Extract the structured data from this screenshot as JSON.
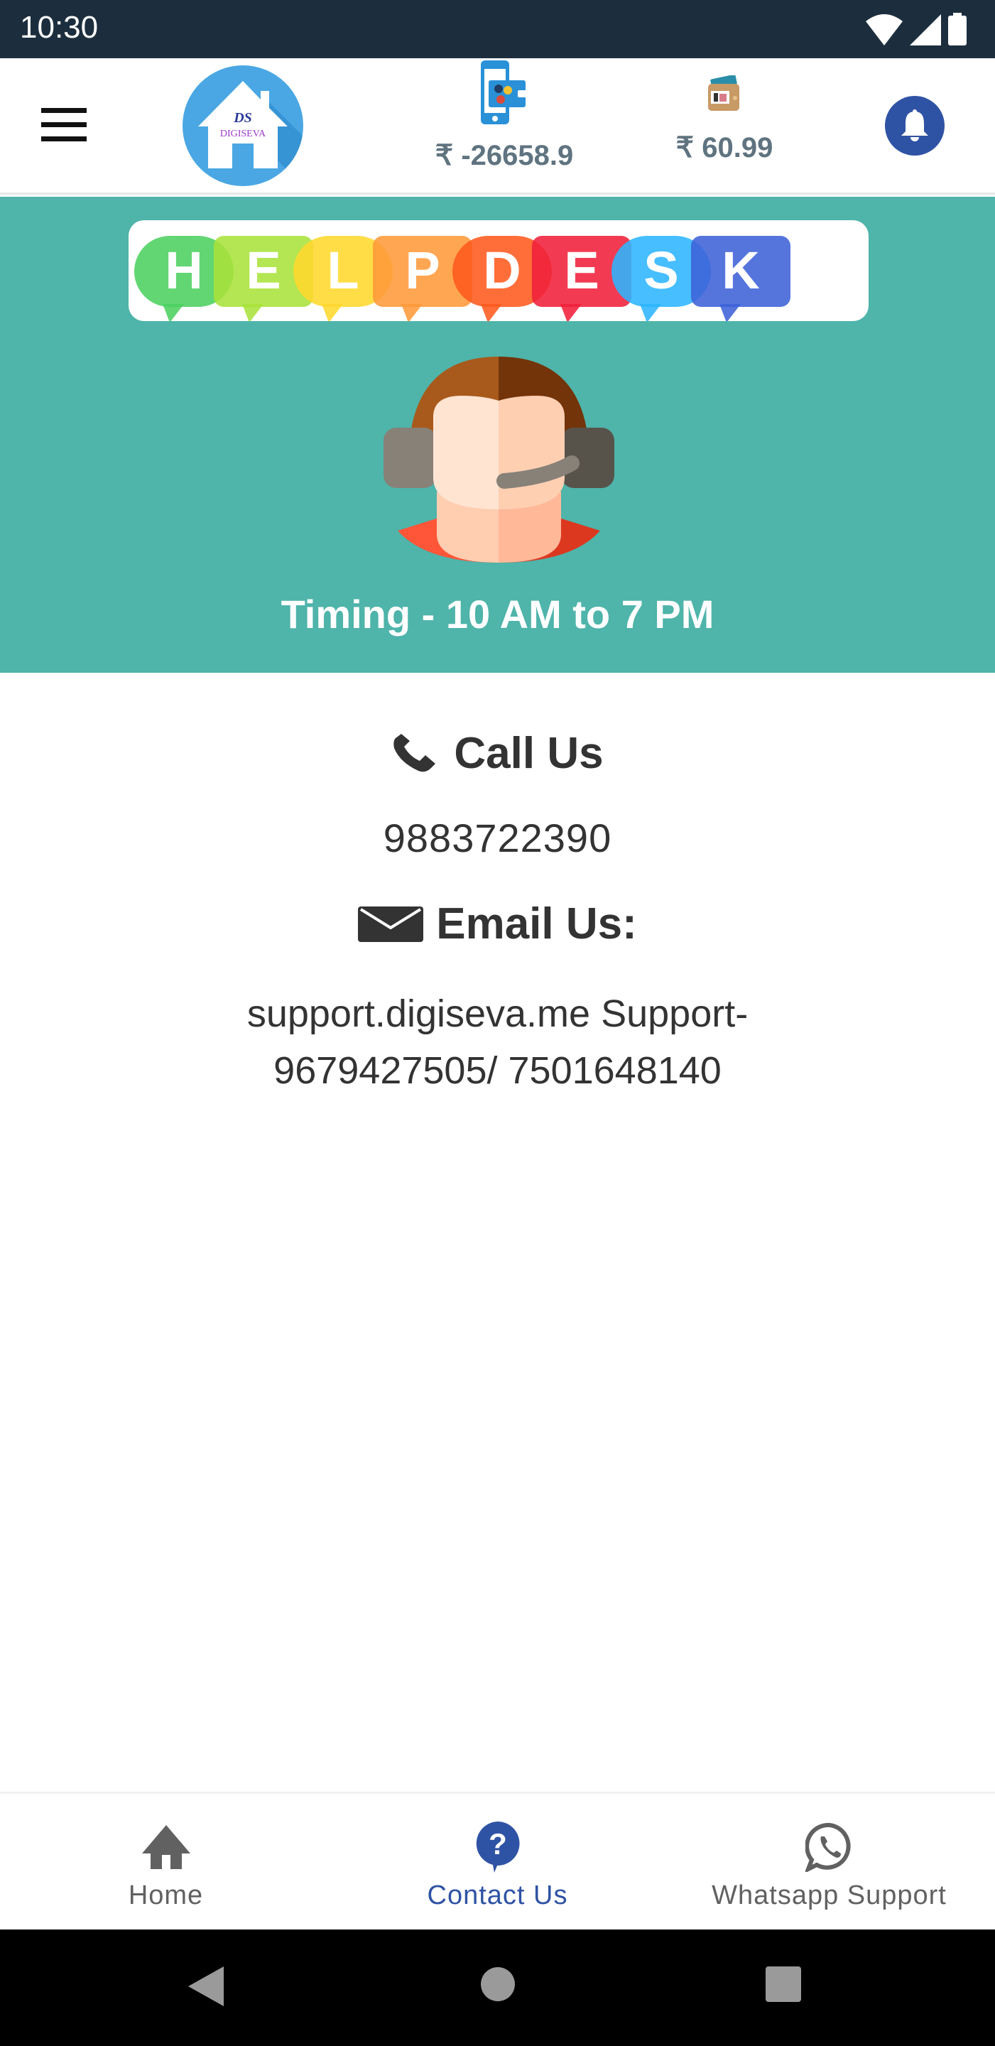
{
  "status_bar": {
    "time": "10:30",
    "icons": [
      "wifi-icon",
      "signal-icon",
      "battery-icon"
    ]
  },
  "app_bar": {
    "menu_icon": "hamburger-menu-icon",
    "logo": {
      "brand": "DIGISEVA",
      "mark": "DS"
    },
    "wallets": [
      {
        "icon": "mobile-wallet-icon",
        "amount": "₹ -26658.9"
      },
      {
        "icon": "wallet-icon",
        "amount": "₹ 60.99"
      }
    ],
    "notification_icon": "bell-icon"
  },
  "banner": {
    "helpdesk_letters": [
      "H",
      "E",
      "L",
      "P",
      "D",
      "E",
      "S",
      "K"
    ],
    "helpdesk_colors": [
      "#4cd060",
      "#a8e23a",
      "#ffd82e",
      "#ff9a3a",
      "#ff5a1e",
      "#f0203a",
      "#2cb5ff",
      "#3d62d8"
    ],
    "timing": "Timing - 10 AM to 7 PM",
    "background_color": "#4fb4aa"
  },
  "contact": {
    "call_heading": "Call Us",
    "call_number": "9883722390",
    "email_heading": "Email Us:",
    "email_line1": "support.digiseva.me Support-",
    "email_line2": "9679427505/ 7501648140"
  },
  "bottom_nav": {
    "items": [
      {
        "label": "Home",
        "icon": "home-icon",
        "active": false
      },
      {
        "label": "Contact Us",
        "icon": "help-question-icon",
        "active": true
      },
      {
        "label": "Whatsapp Support",
        "icon": "whatsapp-icon",
        "active": false
      }
    ],
    "active_color": "#2f53a4",
    "inactive_color": "#616161"
  },
  "system_nav": {
    "buttons": [
      "back-button",
      "home-button",
      "recents-button"
    ]
  }
}
